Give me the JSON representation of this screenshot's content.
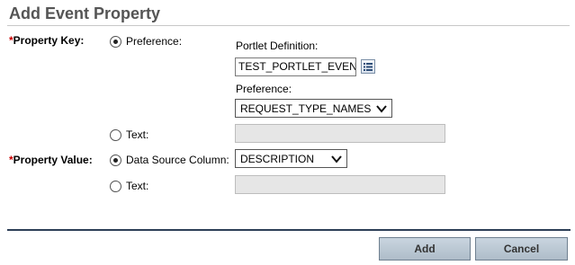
{
  "dialog": {
    "title": "Add Event Property"
  },
  "property_key": {
    "required_mark": "*",
    "label": "Property Key:",
    "preference_option": "Preference:",
    "portlet_definition_label": "Portlet Definition:",
    "portlet_definition_value": "TEST_PORTLET_EVENT",
    "preference_label": "Preference:",
    "preference_value": "REQUEST_TYPE_NAMES",
    "text_option": "Text:",
    "text_value": ""
  },
  "property_value": {
    "required_mark": "*",
    "label": "Property Value:",
    "data_source_option": "Data Source Column:",
    "data_source_value": "DESCRIPTION",
    "text_option": "Text:",
    "text_value": ""
  },
  "actions": {
    "add_label": "Add",
    "cancel_label": "Cancel"
  },
  "colors": {
    "required": "#cc0000",
    "title": "#555555",
    "rule": "#2d3f57",
    "button": "#b8c6d2"
  },
  "icons": {
    "lookup": "list-lookup-icon",
    "dropdown": "chevron-down-icon"
  }
}
